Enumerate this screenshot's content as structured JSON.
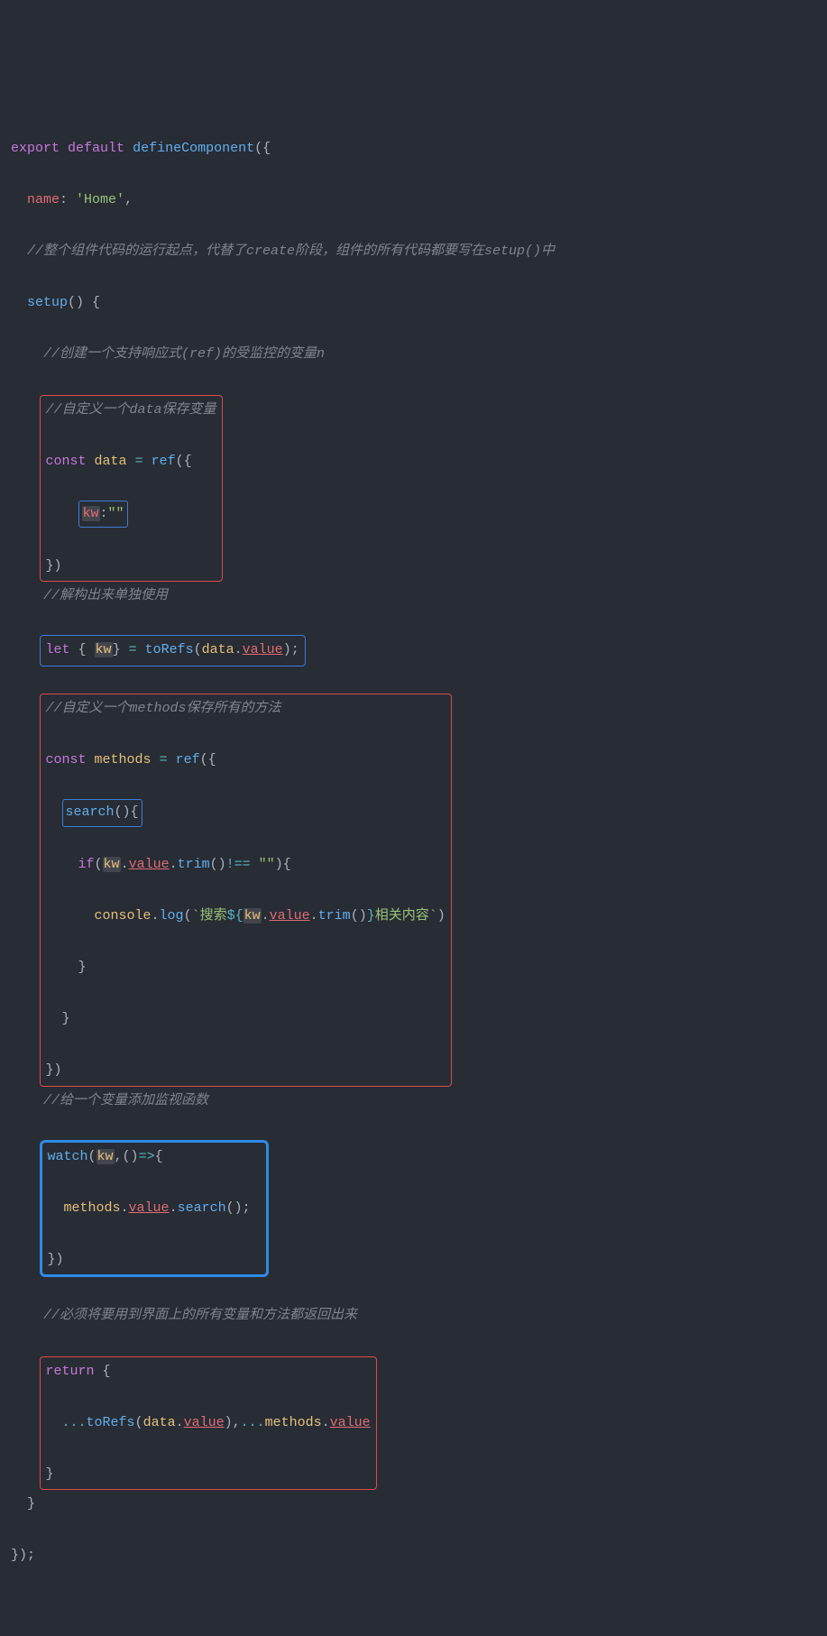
{
  "code": {
    "line1_export": "export",
    "line1_default": "default",
    "line1_defineComponent": "defineComponent",
    "line2_name": "name",
    "line2_home": "'Home'",
    "line3_comment": "//整个组件代码的运行起点，代替了create阶段，组件的所有代码都要写在setup()中",
    "line4_setup": "setup",
    "line5_comment": "//创建一个支持响应式(ref)的受监控的变量n",
    "line6_comment": "//自定义一个data保存变量",
    "line7_const": "const",
    "line7_data": "data",
    "line7_ref": "ref",
    "line8_kw": "kw",
    "line8_val": "\"\"",
    "line10_comment": "//解构出来单独使用",
    "line11_let": "let",
    "line11_kw": "kw",
    "line11_toRefs": "toRefs",
    "line11_data": "data",
    "line11_value": "value",
    "line12_comment": "//自定义一个methods保存所有的方法",
    "line13_const": "const",
    "line13_methods": "methods",
    "line13_ref": "ref",
    "line14_search": "search",
    "line15_if": "if",
    "line15_kw": "kw",
    "line15_value": "value",
    "line15_trim": "trim",
    "line15_neq": "!==",
    "line15_empty": "\"\"",
    "line16_console": "console",
    "line16_log": "log",
    "line16_tpl1": "`搜索",
    "line16_kw": "kw",
    "line16_value": "value",
    "line16_trim": "trim",
    "line16_tpl2": "相关内容`",
    "line20_comment": "//给一个变量添加监视函数",
    "line21_watch": "watch",
    "line21_kw": "kw",
    "line22_methods": "methods",
    "line22_value": "value",
    "line22_search": "search",
    "line24_comment": "//必须将要用到界面上的所有变量和方法都返回出来",
    "line25_return": "return",
    "line26_toRefs": "toRefs",
    "line26_data": "data",
    "line26_value": "value",
    "line26_methods": "methods",
    "line26_value2": "value"
  }
}
